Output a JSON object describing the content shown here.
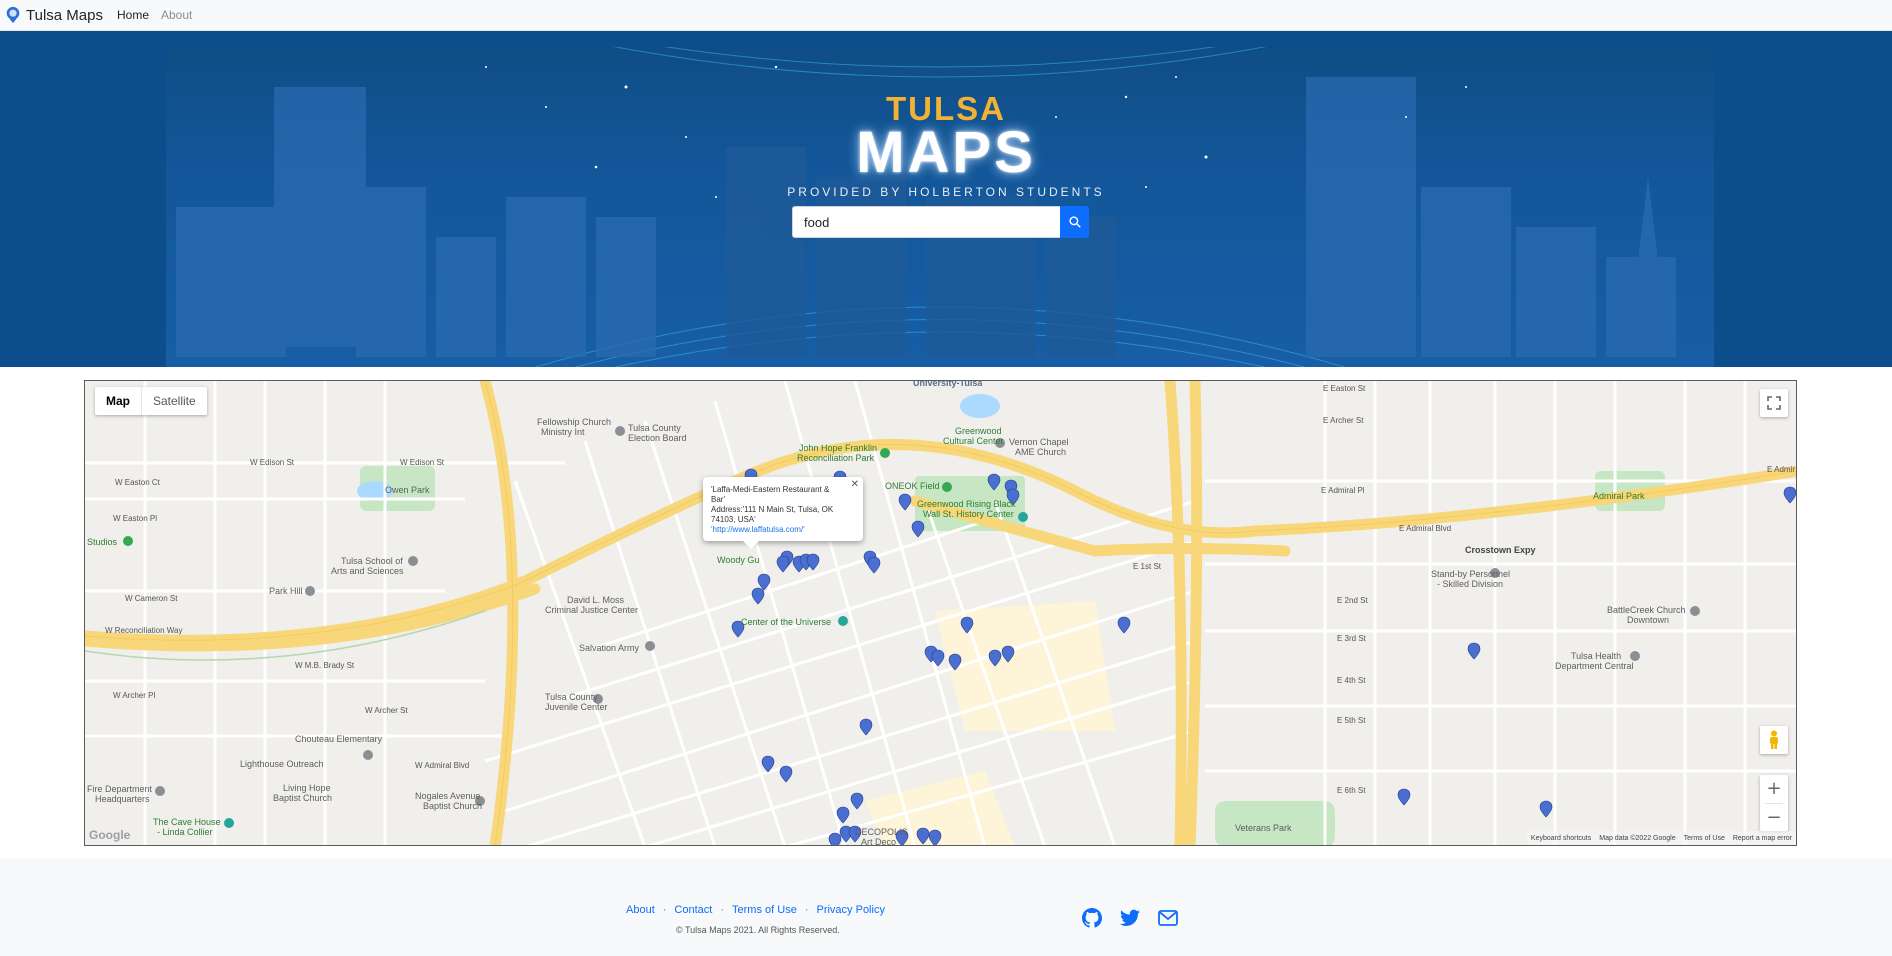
{
  "navbar": {
    "brand": "Tulsa Maps",
    "links": [
      {
        "label": "Home",
        "active": true
      },
      {
        "label": "About",
        "active": false
      }
    ]
  },
  "hero": {
    "title_top": "TULSA",
    "title_bottom": "MAPS",
    "subtitle": "PROVIDED BY HOLBERTON STUDENTS",
    "search": {
      "value": "food"
    }
  },
  "map": {
    "type_buttons": [
      {
        "label": "Map",
        "selected": true
      },
      {
        "label": "Satellite",
        "selected": false
      }
    ],
    "info_window": {
      "name_line1": "'Laffa-Medi-Eastern Restaurant &",
      "name_line2": "Bar'",
      "address_line1": "Address:'111 N Main St, Tulsa, OK",
      "address_line2": "74103, USA'",
      "link": "'http://www.laffatulsa.com/'"
    },
    "footer": [
      "Keyboard shortcuts",
      "Map data ©2022 Google",
      "Terms of Use",
      "Report a map error"
    ],
    "google_logo": "Google",
    "labels": {
      "university": "University-Tulsa",
      "fellowship": "Fellowship Church",
      "fellowship2": "Ministry Int",
      "election": "Tulsa County",
      "election2": "Election Board",
      "greenwood_cc": "Greenwood",
      "greenwood_cc2": "Cultural Center",
      "vernon": "Vernon Chapel",
      "vernon2": "AME Church",
      "jhf_park": "John Hope Franklin",
      "jhf_park2": "Reconciliation Park",
      "oneok": "ONEOK Field",
      "greenwood_rising": "Greenwood Rising Black",
      "greenwood_rising2": "Wall St. History Center",
      "owen_park": "Owen Park",
      "studios": "Studios",
      "school_arts": "Tulsa School of",
      "school_arts2": "Arts and Sciences",
      "park_hill": "Park Hill",
      "moss": "David L. Moss",
      "moss2": "Criminal Justice Center",
      "center_universe": "Center of the Universe",
      "woody": "Woody Gu",
      "salvation": "Salvation Army",
      "juvenile": "Tulsa County",
      "juvenile2": "Juvenile Center",
      "chouteau": "Chouteau Elementary",
      "lighthouse": "Lighthouse Outreach",
      "living_hope": "Living Hope",
      "living_hope2": "Baptist Church",
      "nogales": "Nogales Avenue",
      "nogales2": "Baptist Church",
      "fire_dept": "Fire Department",
      "fire_dept2": "Headquarters",
      "cave_house": "The Cave House",
      "cave_house2": "- Linda Collier",
      "admiral_park": "Admiral Park",
      "standby": "Stand-by Personnel",
      "standby2": "- Skilled Division",
      "battlecreek": "BattleCreek Church",
      "battlecreek2": "Downtown",
      "health_dept": "Tulsa Health",
      "health_dept2": "Department Central",
      "veterans": "Veterans Park",
      "crosstown": "Crosstown Expy",
      "decopolis": "DECOPOLIS",
      "decopolis2": "Art Deco",
      "roads": {
        "w_edison": "W Edison St",
        "w_edison2": "W Edison St",
        "w_easton": "W Easton Ct",
        "w_easton_pl": "W Easton Pl",
        "w_cameron": "W Cameron St",
        "w_recon": "W Reconciliation Way",
        "w_mb_brady": "W M.B. Brady St",
        "w_archer": "W Archer Pl",
        "w_archer_st": "W Archer St",
        "w_admiral": "W Admiral Blvd",
        "e_easton": "E Easton St",
        "e_archer": "E Archer St",
        "e_admiral_pl": "E Admiral Pl",
        "e_admiral_blvd": "E Admiral Blvd",
        "e_1st": "E 1st St",
        "e_2nd": "E 2nd St",
        "e_3rd": "E 3rd St",
        "e_4th": "E 4th St",
        "e_5th": "E 5th St",
        "e_6th": "E 6th St",
        "e_admiral_right": "E Admir"
      }
    }
  },
  "footer": {
    "links": [
      "About",
      "Contact",
      "Terms of Use",
      "Privacy Policy"
    ],
    "copyright": "© Tulsa Maps 2021. All Rights Reserved.",
    "social": [
      "github-icon",
      "twitter-icon",
      "email-icon"
    ]
  },
  "colors": {
    "accent": "#0d6efd",
    "hero_bg": "#0c4d8c",
    "title_gold": "#f2b233",
    "pin": "#4a6fd1",
    "highway": "#f8d77a"
  }
}
